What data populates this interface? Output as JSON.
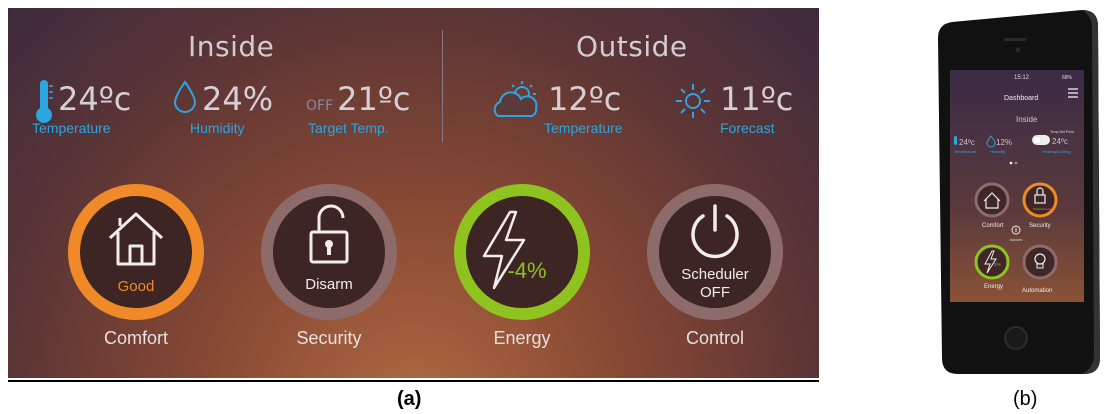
{
  "inside": {
    "title": "Inside",
    "temperature": {
      "value": "24ºc",
      "label": "Temperature"
    },
    "humidity": {
      "value": "24%",
      "label": "Humidity"
    },
    "target": {
      "off": "OFF",
      "value": "21ºc",
      "label": "Target Temp."
    }
  },
  "outside": {
    "title": "Outside",
    "temperature": {
      "value": "12ºc",
      "label": "Temperature"
    },
    "forecast": {
      "value": "11ºc",
      "label": "Forecast"
    }
  },
  "rings": [
    {
      "label": "Comfort",
      "status": "Good",
      "color": "#f08a28"
    },
    {
      "label": "Security",
      "status": "Disarm",
      "color": "#8e6b6b"
    },
    {
      "label": "Energy",
      "status": "-4%",
      "color": "#8fc31f"
    },
    {
      "label": "Control",
      "status": "Scheduler",
      "status2": "OFF",
      "color": "#8e6b6b"
    }
  ],
  "captions": {
    "a": "(a)",
    "b": "(b)"
  },
  "phone": {
    "time": "15:12",
    "battery": "68%",
    "title": "Dashboard",
    "section": "Inside",
    "temp": "24ºc",
    "temp_label": "Temperature",
    "humidity": "12%",
    "humidity_label": "Humidity",
    "setpoint_label": "Temp Set Point",
    "setpoint": "24ºc",
    "mode_label": "Heating/Cooling",
    "tiles": [
      {
        "label": "Comfort"
      },
      {
        "label": "Security",
        "sub": "Partial Armed"
      },
      {
        "label": "Energy",
        "sub": "2%"
      },
      {
        "label": "Automation"
      }
    ],
    "advice": "Advices"
  }
}
